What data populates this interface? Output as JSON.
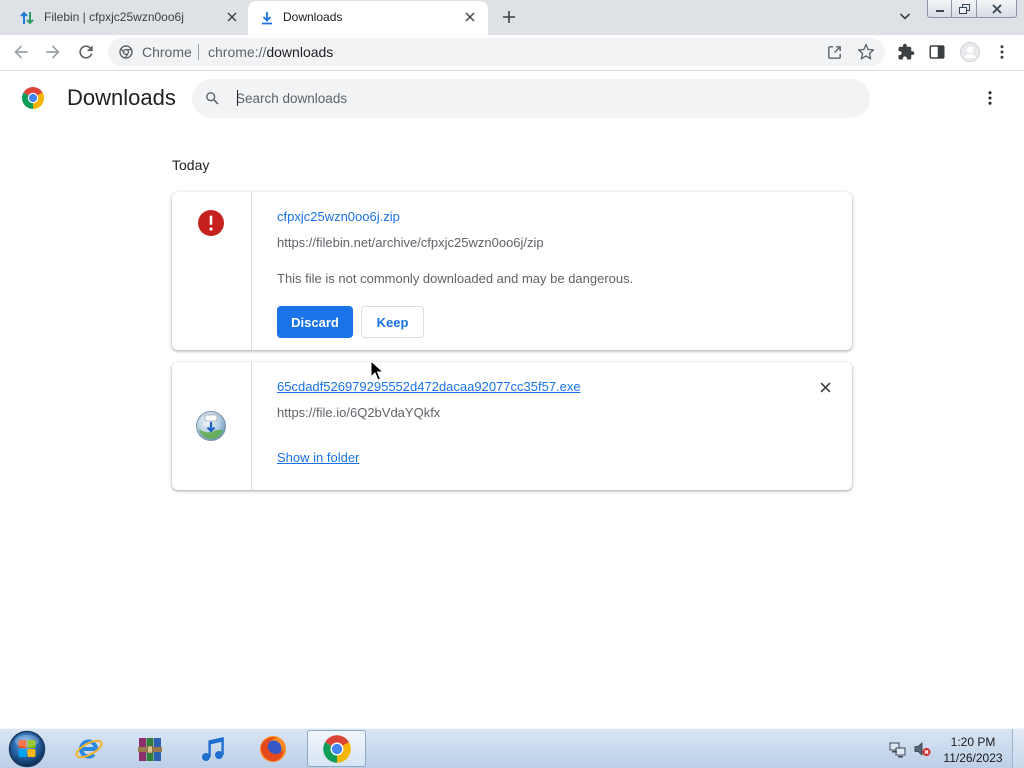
{
  "window": {
    "tabs": [
      {
        "title": "Filebin | cfpxjc25wzn0oo6j",
        "icon": "filebin-arrows-icon",
        "active": false
      },
      {
        "title": "Downloads",
        "icon": "download-icon",
        "active": true
      }
    ],
    "new_tab_icon": "plus-icon",
    "tab_search_icon": "chevron-down-icon",
    "window_controls": [
      "minimize-icon",
      "restore-icon",
      "close-window-icon"
    ]
  },
  "toolbar": {
    "icons": [
      "back-arrow-icon",
      "forward-arrow-icon",
      "reload-icon",
      "share-icon",
      "star-icon",
      "extensions-puzzle-icon",
      "side-panel-icon",
      "profile-avatar-icon",
      "kebab-menu-icon"
    ],
    "omnibox": {
      "site_chip": "Chrome",
      "url_scheme": "chrome://",
      "url_host": "downloads"
    }
  },
  "page": {
    "logo_icon": "chrome-logo-icon",
    "title": "Downloads",
    "search": {
      "placeholder": "Search downloads",
      "icon": "search-icon"
    },
    "menu_icon": "kebab-menu-icon",
    "date_header": "Today",
    "downloads": [
      {
        "icon": "danger-icon",
        "filename": "cfpxjc25wzn0oo6j.zip",
        "url": "https://filebin.net/archive/cfpxjc25wzn0oo6j/zip",
        "warning": "This file is not commonly downloaded and may be dangerous.",
        "discard_label": "Discard",
        "keep_label": "Keep"
      },
      {
        "icon": "installer-globe-icon",
        "filename": "65cdadf526979295552d472dacaa92077cc35f57.exe",
        "url": "https://file.io/6Q2bVdaYQkfx",
        "show_in_folder_label": "Show in folder",
        "remove_icon": "close-icon"
      }
    ]
  },
  "taskbar": {
    "start_icon": "windows-start-orb-icon",
    "pinned": [
      "internet-explorer-icon",
      "winrar-icon",
      "music-player-icon",
      "firefox-icon",
      "chrome-icon"
    ],
    "active_app": "chrome-icon",
    "tray_icons": [
      "network-icon",
      "volume-muted-icon"
    ],
    "clock": {
      "time": "1:20 PM",
      "date": "11/26/2023"
    }
  },
  "colors": {
    "accent": "#1a73e8",
    "danger": "#c5221f",
    "frame": "#dee1e6",
    "omnibox_bg": "#f1f3f4",
    "secondary_text": "#5f6368"
  }
}
